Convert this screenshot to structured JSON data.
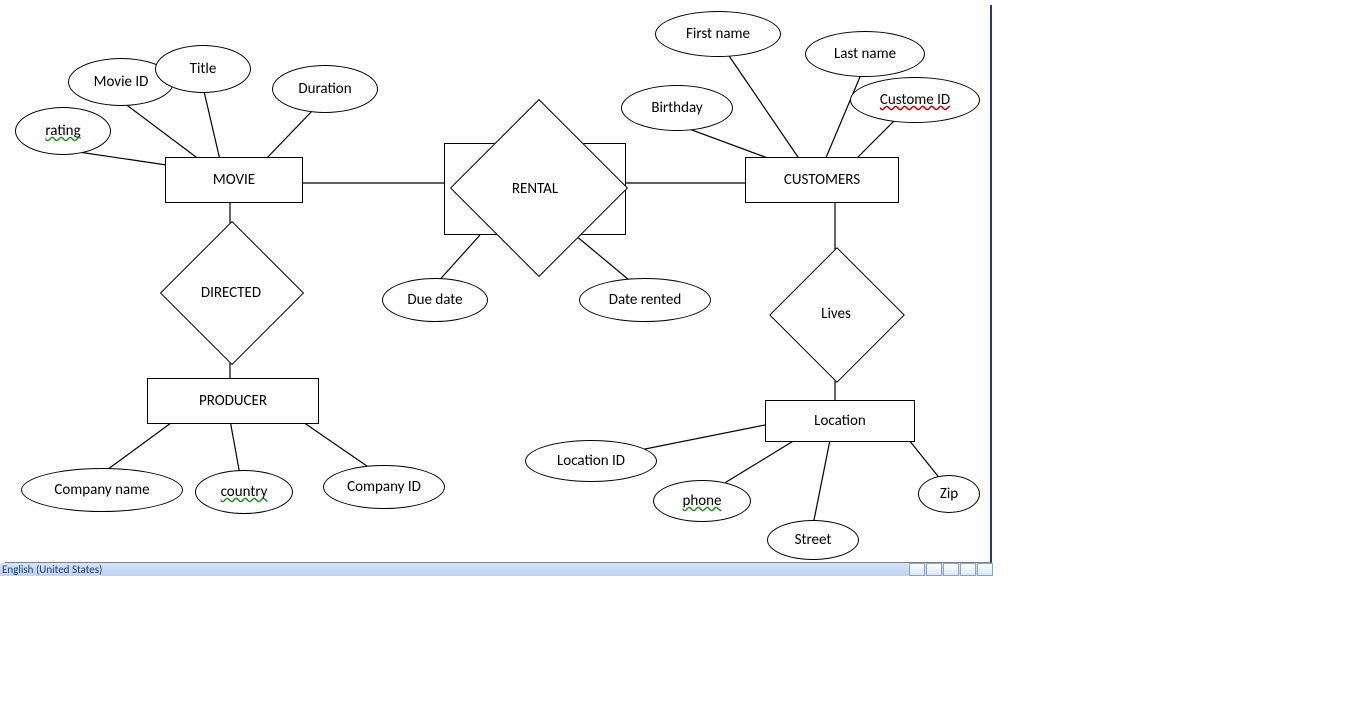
{
  "statusbar": {
    "language": "English (United States)"
  },
  "entities": {
    "movie": "MOVIE",
    "producer": "PRODUCER",
    "customers": "CUSTOMERS",
    "location": "Location"
  },
  "relationships": {
    "rental": "RENTAL",
    "directed": "DIRECTED",
    "lives": "Lives"
  },
  "attributes": {
    "movie_id": "Movie ID",
    "title": "Title",
    "duration": "Duration",
    "rating": "rating",
    "due_date": "Due date",
    "date_rented": "Date rented",
    "first_name": "First name",
    "last_name": "Last name",
    "custome_id": "Custome ID",
    "birthday": "Birthday",
    "company_name": "Company name",
    "country": "country",
    "company_id": "Company ID",
    "location_id": "Location ID",
    "phone": "phone",
    "street": "Street",
    "zip": "Zip"
  }
}
